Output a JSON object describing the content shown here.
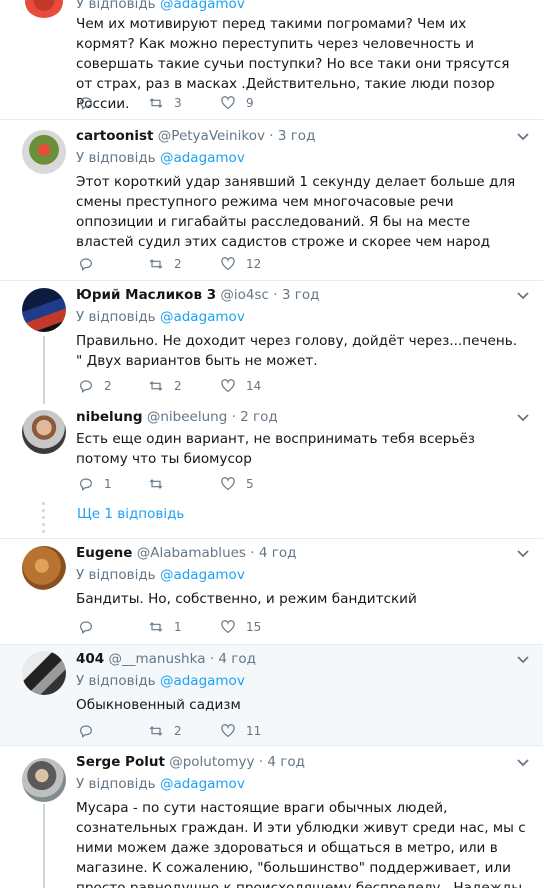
{
  "tweets": [
    {
      "replying_prefix": "У відповідь",
      "replying_handle": "@adagamov",
      "text": "Чем их мотивируют перед такими погромами? Чем их кормят? Как можно переступить через человечность и совершать такие сучьи поступки? Но все таки они трясутся от страх, раз в масках .Действительно, такие люди позор России.",
      "replies": "",
      "retweets": "3",
      "likes": "9"
    },
    {
      "name": "cartoonist",
      "handle": "@PetyaVeinikov",
      "time": "· 3 год",
      "replying_prefix": "У відповідь",
      "replying_handle": "@adagamov",
      "text": "Этот короткий удар занявший 1 секунду делает больше для смены преступного режима чем многочасовые речи оппозиции и гигабайты расследований. Я бы на месте властей судил этих садистов строже и скорее чем народ",
      "replies": "",
      "retweets": "2",
      "likes": "12"
    },
    {
      "name": "Юрий Масликов 3",
      "handle": "@io4sc",
      "time": "· 3 год",
      "replying_prefix": "У відповідь",
      "replying_handle": "@adagamov",
      "text": "Правильно. Не доходит через голову, дойдёт через...печень. \" Двух вариантов быть не может.",
      "replies": "2",
      "retweets": "2",
      "likes": "14"
    },
    {
      "name": "nibelung",
      "handle": "@nibeelung",
      "time": "· 2 год",
      "text": "Есть еще один вариант, не воспринимать тебя всерьёз потому что ты биомусор",
      "replies": "1",
      "retweets": "",
      "likes": "5"
    },
    {
      "name": "Eugene",
      "handle": "@Alabamablues",
      "time": "· 4 год",
      "replying_prefix": "У відповідь",
      "replying_handle": "@adagamov",
      "text": "Бандиты. Но, собственно, и режим бандитский",
      "replies": "",
      "retweets": "1",
      "likes": "15"
    },
    {
      "name": "404",
      "handle": "@__manushka",
      "time": "· 4 год",
      "replying_prefix": "У відповідь",
      "replying_handle": "@adagamov",
      "text": "Обыкновенный садизм",
      "replies": "",
      "retweets": "2",
      "likes": "11"
    },
    {
      "name": "Serge Polut",
      "handle": "@polutomyy",
      "time": "· 4 год",
      "replying_prefix": "У відповідь",
      "replying_handle": "@adagamov",
      "text": "Мусара - по сути настоящие враги обычных людей, сознательных граждан. И эти ублюдки живут среди нас, мы с ними можем даже здороваться и общаться в метро, или в магазине. К сожалению, \"большинство\" поддерживает, или просто равнодушно к происходящему беспределу.. Надежды нет."
    }
  ],
  "show_more": "Ще 1 відповідь",
  "colors": {
    "link": "#1da1f2",
    "muted": "#657786",
    "border": "#e6ecf0",
    "highlight": "#f5f8fa"
  },
  "icons": [
    "reply-icon",
    "retweet-icon",
    "like-icon",
    "chevron-down-icon"
  ]
}
